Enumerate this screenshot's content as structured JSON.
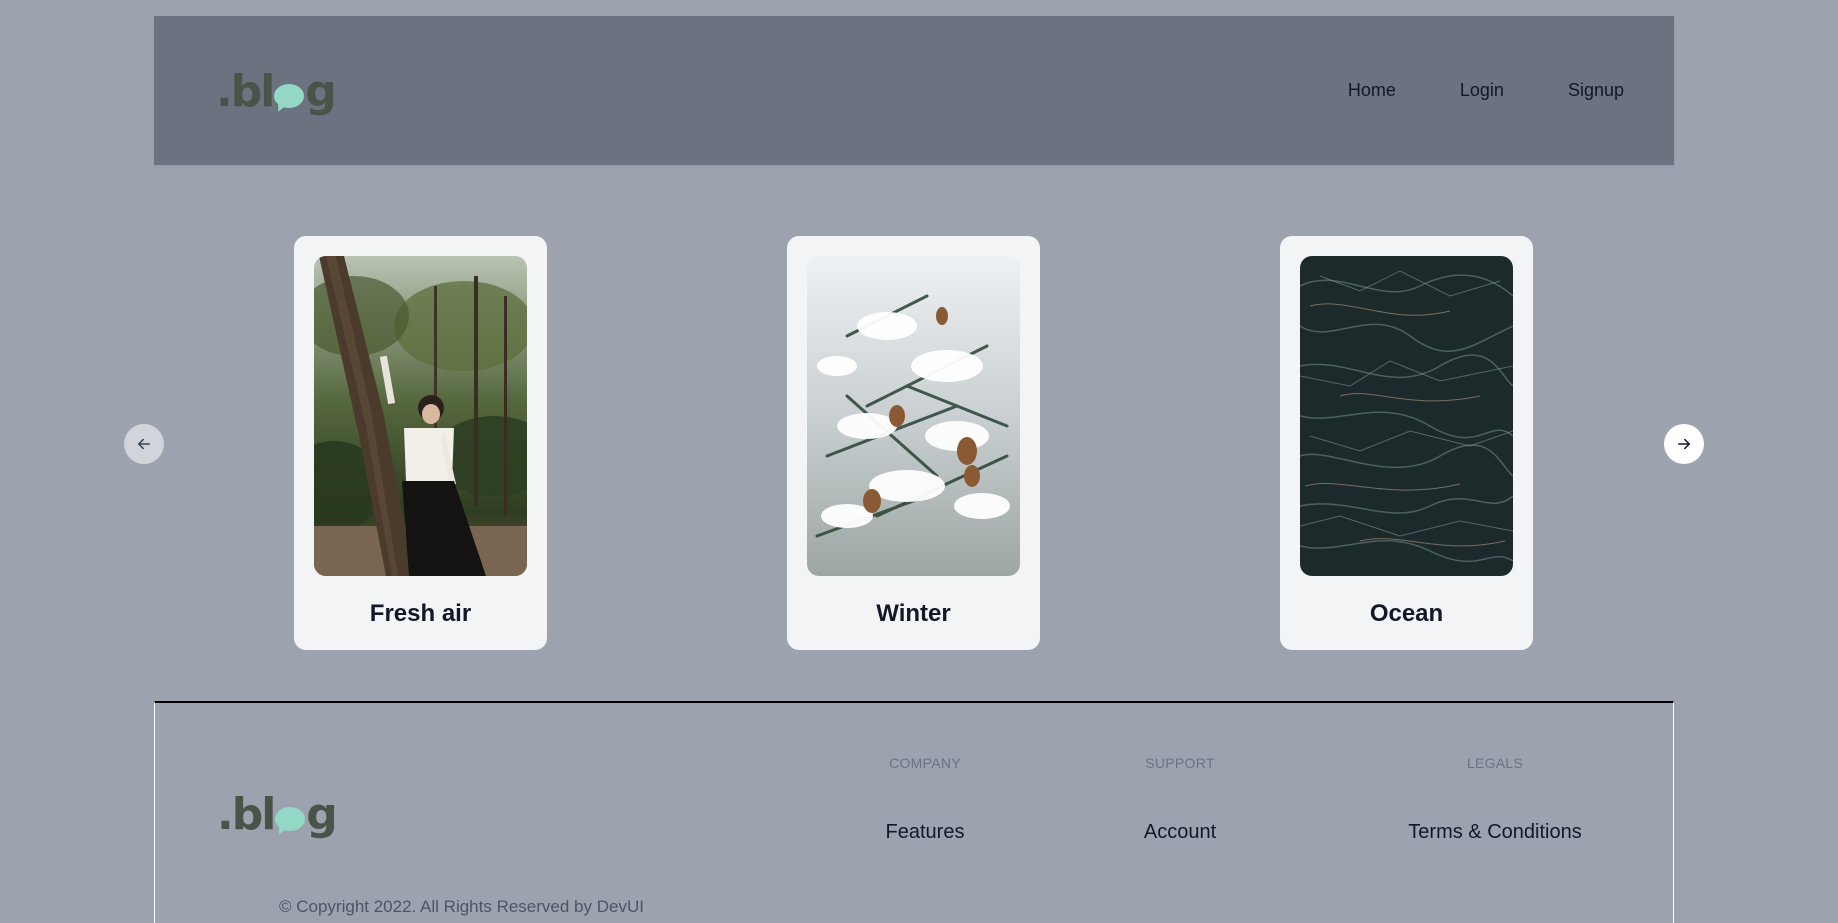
{
  "header": {
    "logo": {
      "prefix": ".bl",
      "suffix": "g"
    },
    "nav": [
      {
        "label": "Home"
      },
      {
        "label": "Login"
      },
      {
        "label": "Signup"
      }
    ]
  },
  "carousel": {
    "prev_icon": "arrow-left-icon",
    "next_icon": "arrow-right-icon",
    "cards": [
      {
        "title": "Fresh air",
        "image": "woman-leaning-on-tree-in-forest"
      },
      {
        "title": "Winter",
        "image": "snow-covered-pine-branch-with-cones"
      },
      {
        "title": "Ocean",
        "image": "dark-ocean-waves-aerial"
      }
    ]
  },
  "footer": {
    "logo": {
      "prefix": ".bl",
      "suffix": "g"
    },
    "columns": [
      {
        "heading": "COMPANY",
        "link": "Features"
      },
      {
        "heading": "SUPPORT",
        "link": "Account"
      },
      {
        "heading": "LEGALS",
        "link": "Terms & Conditions"
      }
    ],
    "copyright": "© Copyright 2022. All Rights Reserved by DevUI"
  },
  "colors": {
    "page_bg": "#9ca3af",
    "header_bg": "#6b7280",
    "card_bg": "#f3f4f6",
    "logo_text": "#4a5347",
    "logo_accent": "#93d7c5"
  }
}
